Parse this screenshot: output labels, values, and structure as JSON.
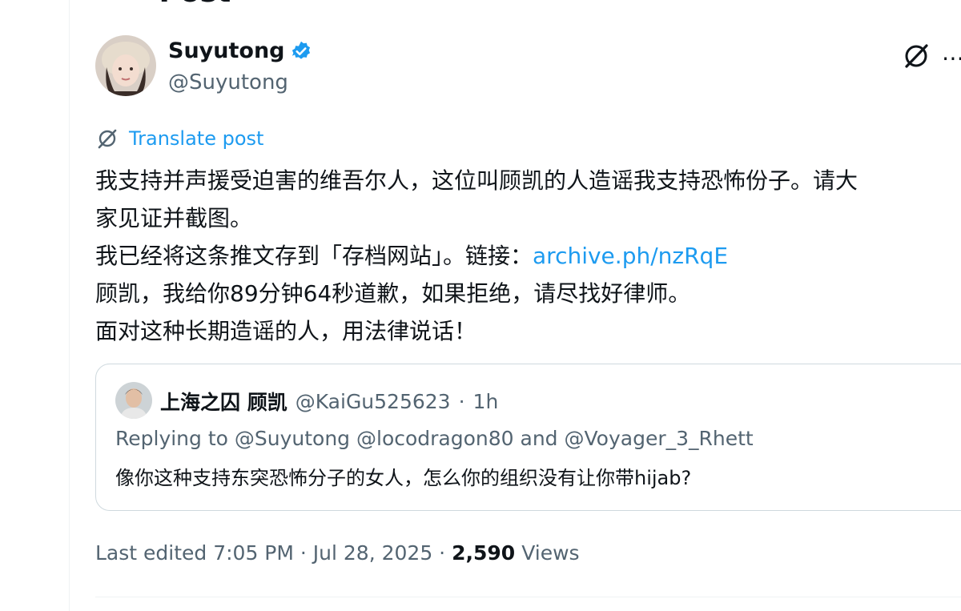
{
  "header": {
    "back_icon": "arrow-left-icon",
    "title": "Post"
  },
  "post": {
    "author": {
      "name": "Suyutong",
      "handle": "@Suyutong",
      "verified": true,
      "verified_color": "#1d9bf0"
    },
    "translate_label": "Translate post",
    "lines": [
      "我支持并声援受迫害的维吾尔人，这位叫顾凯的人造谣我支持恐怖份子。请大",
      "家见证并截图。",
      "我已经将这条推文存到「存档网站」。链接：",
      "顾凯，我给你89分钟64秒道歉，如果拒绝，请尽找好律师。",
      "面对这种长期造谣的人，用法律说话！"
    ],
    "link_text": "archive.ph/nzRqE",
    "link_color": "#1d9bf0"
  },
  "quote": {
    "author_name": "上海之囚 顾凯",
    "handle": "@KaiGu525623",
    "separator": "·",
    "time": "1h",
    "replying_to": "Replying to @Suyutong @locodragon80 and @Voyager_3_Rhett",
    "text": "像你这种支持东突恐怖分子的女人，怎么你的组织没有让你带hijab?"
  },
  "meta": {
    "edited": "Last edited 7:05 PM · Jul 28, 2025 ·",
    "views_count": "2,590",
    "views_label": "Views"
  },
  "icons": {
    "grok": "grok-icon",
    "more": "more-options-icon",
    "translate": "translate-icon"
  }
}
